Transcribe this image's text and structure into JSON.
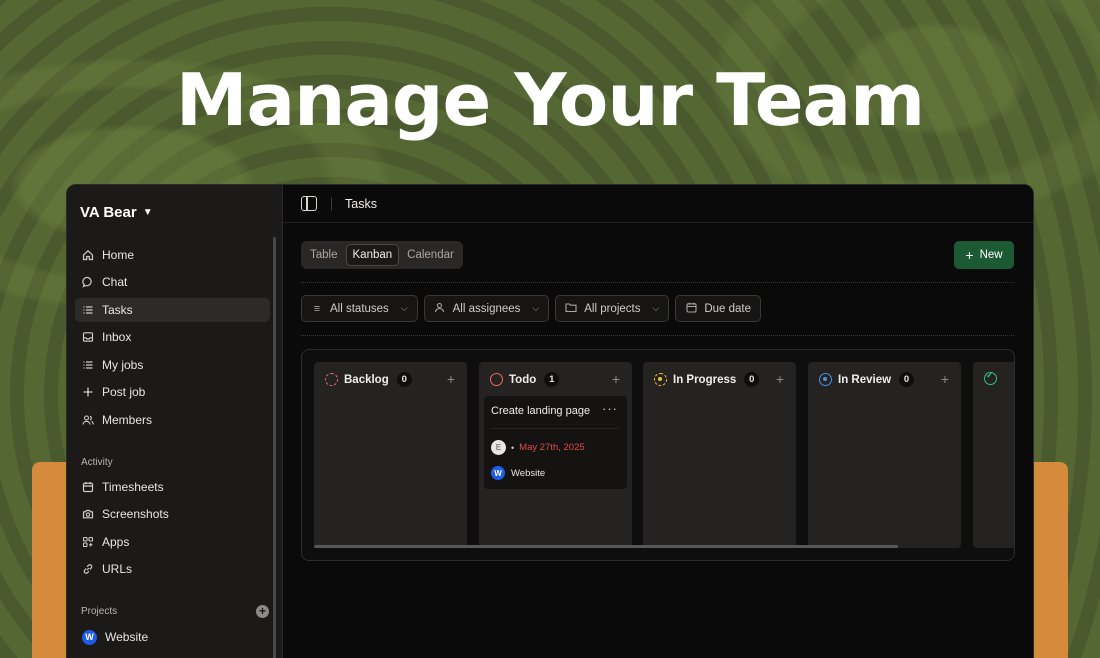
{
  "hero": {
    "title": "Manage Your Team"
  },
  "app": {
    "workspace": {
      "name": "VA Bear",
      "chevron": "chevron-down-icon"
    },
    "sidebar": {
      "items": [
        {
          "label": "Home",
          "icon": "home-icon"
        },
        {
          "label": "Chat",
          "icon": "chat-icon"
        },
        {
          "label": "Tasks",
          "icon": "list-icon",
          "active": true
        },
        {
          "label": "Inbox",
          "icon": "inbox-icon"
        },
        {
          "label": "My jobs",
          "icon": "list-icon"
        },
        {
          "label": "Post job",
          "icon": "plus-icon"
        },
        {
          "label": "Members",
          "icon": "users-icon"
        }
      ],
      "activity_label": "Activity",
      "activity_items": [
        {
          "label": "Timesheets",
          "icon": "calendar-icon"
        },
        {
          "label": "Screenshots",
          "icon": "camera-icon"
        },
        {
          "label": "Apps",
          "icon": "apps-icon"
        },
        {
          "label": "URLs",
          "icon": "link-icon"
        }
      ],
      "projects_label": "Projects",
      "projects": [
        {
          "label": "Website",
          "badge": "W",
          "color": "#1e5be6"
        }
      ]
    },
    "topbar": {
      "title": "Tasks"
    },
    "view_tabs": [
      {
        "label": "Table"
      },
      {
        "label": "Kanban",
        "active": true
      },
      {
        "label": "Calendar"
      }
    ],
    "new_button": {
      "label": "New"
    },
    "filters": [
      {
        "label": "All statuses",
        "icon": "status-filter-icon"
      },
      {
        "label": "All assignees",
        "icon": "user-icon"
      },
      {
        "label": "All projects",
        "icon": "folder-icon"
      },
      {
        "label": "Due date",
        "icon": "calendar-icon"
      }
    ],
    "columns": [
      {
        "title": "Backlog",
        "count": "0",
        "status_color": "#e0609a"
      },
      {
        "title": "Todo",
        "count": "1",
        "status_color": "#f06a6a"
      },
      {
        "title": "In Progress",
        "count": "0",
        "status_color": "#e8c032"
      },
      {
        "title": "In Review",
        "count": "0",
        "status_color": "#4b8fe8"
      },
      {
        "title": "",
        "count": "",
        "status_color": "#2fbf80"
      }
    ],
    "card": {
      "title": "Create landing page",
      "assignee_initial": "E",
      "due_date": "May 27th, 2025",
      "due_color": "#e24a4a",
      "project_badge": "W",
      "project_label": "Website"
    },
    "colors": {
      "accent_button": "#1c5a34",
      "project_blue": "#1e5be6",
      "orange_panel": "#d58a3c"
    }
  }
}
